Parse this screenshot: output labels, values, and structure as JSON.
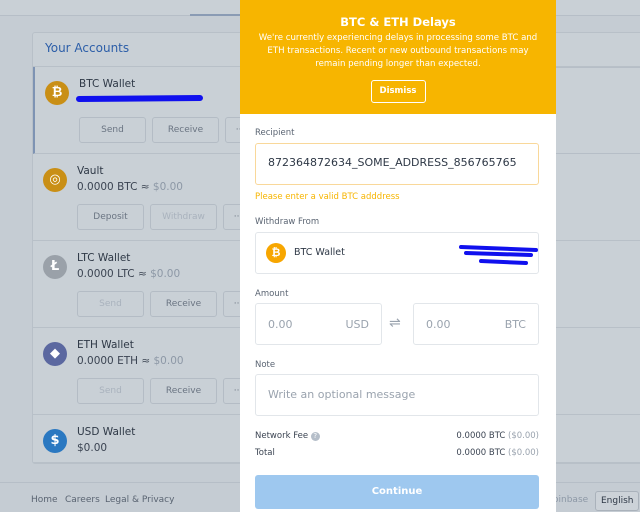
{
  "accounts": {
    "title": "Your Accounts",
    "rows": [
      {
        "name": "BTC Wallet",
        "balance": "",
        "fiat": "",
        "icon": "bitcoin-icon",
        "color": "#c98f16",
        "buttons": [
          "Send",
          "Receive"
        ]
      },
      {
        "name": "Vault",
        "balance": "0.0000 BTC ≈ ",
        "fiat": "$0.00",
        "icon": "vault-icon",
        "color": "#c98f16",
        "buttons": [
          "Deposit",
          "Withdraw"
        ]
      },
      {
        "name": "LTC Wallet",
        "balance": "0.0000 LTC ≈ ",
        "fiat": "$0.00",
        "icon": "litecoin-icon",
        "color": "#9aa1a9",
        "buttons": [
          "Send",
          "Receive"
        ]
      },
      {
        "name": "ETH Wallet",
        "balance": "0.0000 ETH ≈ ",
        "fiat": "$0.00",
        "icon": "ethereum-icon",
        "color": "#5b68a0",
        "buttons": [
          "Send",
          "Receive"
        ]
      },
      {
        "name": "USD Wallet",
        "balance": "$0.00",
        "fiat": "",
        "icon": "dollar-icon",
        "color": "#2a78c1",
        "buttons": []
      }
    ]
  },
  "footer": {
    "links": [
      "Home",
      "Careers",
      "Legal & Privacy"
    ],
    "brand": "oinbase",
    "language": "English"
  },
  "banner": {
    "title": "BTC & ETH Delays",
    "message": "We're currently experiencing delays in processing some BTC and ETH transactions. Recent or new outbound transactions may remain pending longer than expected.",
    "dismiss": "Dismiss",
    "color": "#f7b500"
  },
  "form": {
    "recipient_label": "Recipient",
    "recipient_value": "872364872634_SOME_ADDRESS_856765765",
    "recipient_error": "Please enter a valid BTC adddress",
    "withdraw_label": "Withdraw From",
    "withdraw_account": "BTC Wallet",
    "amount_label": "Amount",
    "usd_placeholder": "0.00",
    "usd_unit": "USD",
    "btc_placeholder": "0.00",
    "btc_unit": "BTC",
    "note_label": "Note",
    "note_placeholder": "Write an optional message",
    "fee_label": "Network Fee",
    "fee_value": "0.0000 BTC",
    "fee_fiat": "($0.00)",
    "total_label": "Total",
    "total_value": "0.0000 BTC",
    "total_fiat": "($0.00)",
    "continue": "Continue"
  }
}
